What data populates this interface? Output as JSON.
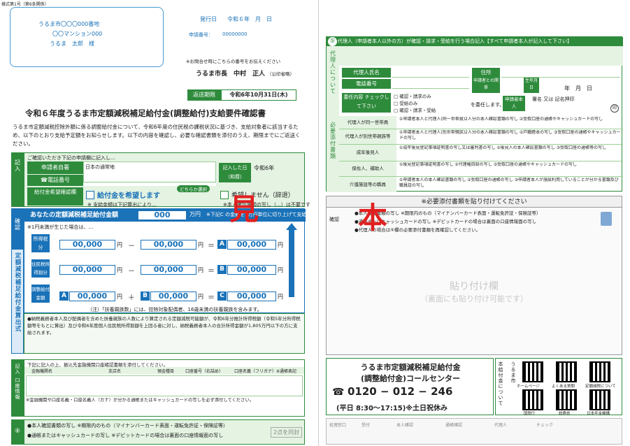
{
  "form_no": "様式第1号（第6条関係）",
  "address": {
    "line1": "うるま市〇〇〇000番地",
    "line2": "〇〇マンション000",
    "name": "うるま　太郎　様"
  },
  "issue": {
    "date_label": "発行日",
    "date": "令和６年　月　日",
    "app_no_label": "申請番号：",
    "app_no": "00000000"
  },
  "contact_note": "※お問合せ時にこちらの番号をお伝えください",
  "mayor": "うるま市長　中村　正人",
  "mayor_note": "（公印省略）",
  "deadline": {
    "label": "返送期限",
    "value": "令和6年10月31日(木)"
  },
  "title": "令和６年度うるま市定額減税補足給付金(調整給付)支給要件確認書",
  "intro": "うるま市定額減税控除外額に係る調整給付金について、令和6年度の住民税の課税状況に基づき、支給対象者に該当するため、以下のとおり支給予定額をお知らせします。以下の内容を確認し、必要な確認書類を添付のうえ、期限までにご返送ください。",
  "sec1": {
    "header": "①記入",
    "note": "ご確認いただき下記の申請欄に記入し…",
    "applicant_label": "申請者自署",
    "japan_only": "日本の通常地",
    "phone_label": "☎電話番号",
    "filled_date_label": "記入した日（和暦）",
    "filled_date": "令和6年",
    "want_label": "給付金希望確認欄",
    "want_yes": "給付金を希望します",
    "choose": "どちらか選択",
    "want_no": "希望しません（辞退）",
    "note2": "※ 支給金額は下記算出により…",
    "note3": "※本人確認書類の写し（…）は不要です"
  },
  "sec2": {
    "label": "②確認",
    "header": "あなたの定額減税補足給付金額",
    "amount": "000",
    "unit": "万円",
    "tail": "※下記C の金額を1万円単位に切り上げて支給",
    "small": "※1円未満が生じた場合は、…",
    "rows": [
      {
        "name": "所得税分",
        "a": "00,000",
        "b": "00,000",
        "c": "00,000"
      },
      {
        "name": "住民税所得割分",
        "a": "00,000",
        "b": "00,000",
        "c": "00,000"
      },
      {
        "name": "調整給付金額",
        "a": "00,000",
        "b": "00,000",
        "c": "00,000"
      }
    ],
    "yen": "円",
    "minus": "－",
    "eq": "＝",
    "plus": "＋",
    "foot": "（注）「扶養親族数」には、控除対象配偶者、16歳未満の扶養親族を含みます。"
  },
  "sec3": {
    "label": "③記入",
    "vlabel": "口座情報",
    "header": "下記に記入の上、振込先金融機関口座確認書類を添付してください。",
    "cols": [
      "金融機関名",
      "支店名",
      "預金種目",
      "口座番号（右詰め）",
      "口座名義（フリガナ）※通帳表記"
    ],
    "note": "※金融機関や口座名義・口座名義人（カナ）が分かる通帳またはキャッシュカードの写しを必ず添付してください。"
  },
  "sec4": {
    "label": "④",
    "items": [
      "●本人確認書類の写し ※期限内のもの（マイナンバーカード表面・運転免許証・保険証等）",
      "●通帳またはキャッシュカードの写し ※デビットカードの場合は裏面の口座情報面の写し"
    ],
    "badge": "2点を同封"
  },
  "calc_side": "定額減税補足給付金算出式",
  "notes_small": "●納税義務者本人及び配偶者を含めた扶養親族の人数により算定される定額減税可能額が、令和6年分推計所得税額（令和5年分所得税額等をもとに算出）及び令和6年度個人住民税所得割額を上回る者に対し、納税義務者本人の合計所得金額が1,805万円以下の方に支給されます。",
  "sec5": {
    "header": "代理人（申請者本人以外の方）が確認・請求・受給を行う場合記入【すべて申請者本人が記入して下さい】",
    "vlabel": "代理人について",
    "name_label": "代理人氏名",
    "address_label": "住所",
    "phone_label": "電話番号",
    "relation_label": "申請者との関係",
    "birth_label": "生年月日",
    "birth_val": "年　月　日",
    "mandate_label": "委任内容 チェックして下さい",
    "options": [
      "確認・請求のみ",
      "受給のみ",
      "確認・請求・受給"
    ],
    "mandate_tail": "を委任します。",
    "principal_label": "申請者本人",
    "sign_label": "署名 又は 記名押印",
    "docs_vlabel": "必要添付書類",
    "docs": [
      {
        "who": "代理人が同一世帯員",
        "what": "①申請者本人と代理人(同一世帯員)2人分の本人確認書類の写し ②受取口座の通帳やキャッシュカードの写し"
      },
      {
        "who": "代理人が別世帯親族等",
        "what": "①申請者本人と代理人(別世帯親族)2人分の本人確認書類の写し ②戸籍謄本の写し ③受取口座の通帳やキャッシュカードの写し"
      },
      {
        "who": "成年後見人",
        "what": "①成年後見登記事項証明書の写し又は審判書の写し ②後見人の本人確認書類の写し ③受取口座の通帳等の写し"
      },
      {
        "who": "保佐人、補助人",
        "what": "①後見登記事項証明書の写し ②代理権目録の写し ③受取口座の通帳やキャッシュカードの写し"
      },
      {
        "who": "介護施設等の職員",
        "what": "①申請者本人の本人確認書類の写し ②受取口座の通帳の写し ③申請者本人が施設利用していることが分かる書類及び職員証の写し"
      }
    ]
  },
  "paste": {
    "header": "※必要添付書類を貼り付けてください",
    "confirm": "確認",
    "items": [
      "●本人確認書類の写し ※期限内のもの（マイナンバーカード表面・運転免許証・保険証等）",
      "●通帳またはキャッシュカードの写し ※デビットカードの場合は裏面の口座情報面の写し",
      "●代理人の場合は⑤欄の必要添付書類を再確認してください。"
    ],
    "center": "貼り付け欄",
    "sub": "（裏面にも貼り付け可能です）"
  },
  "call": {
    "line1": "うるま市定額減税補足給付金",
    "line2": "(調整給付金)コールセンター",
    "phone": "0120 − 012 − 246",
    "hours": "(平日 8:30〜17:15)※土日祝休み",
    "side": "本給付金について",
    "qr_city": "うるま市",
    "qr": [
      "ホームページ",
      "よくある質問",
      "定額減税について",
      "国税庁",
      "総務省",
      "日本年金機構"
    ]
  },
  "office": {
    "labels": [
      "処理窓口",
      "受付",
      "本人確認",
      "通帳確認",
      "代理人",
      "チェック"
    ]
  },
  "stamps": {
    "mihon_left": "見",
    "mihon_right": "本"
  }
}
